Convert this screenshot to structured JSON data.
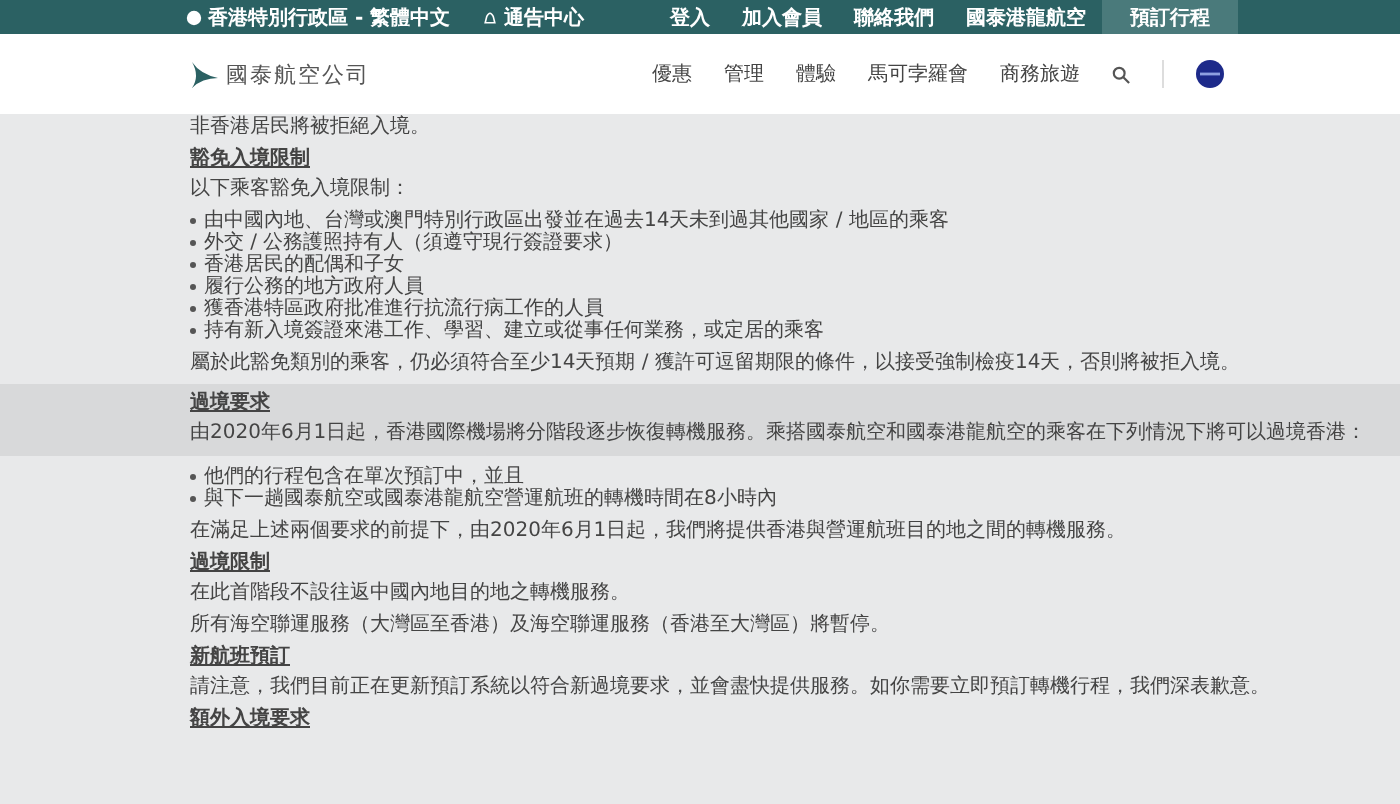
{
  "top_bar": {
    "region": "香港特別行政區 - 繁體中文",
    "notices": "通告中心",
    "links": [
      {
        "label": "登入",
        "selected": false
      },
      {
        "label": "加入會員",
        "selected": false
      },
      {
        "label": "聯絡我們",
        "selected": false
      },
      {
        "label": "國泰港龍航空",
        "selected": false
      },
      {
        "label": "預訂行程",
        "selected": true
      }
    ]
  },
  "header": {
    "logo_text": "國泰航空公司",
    "nav": [
      "優惠",
      "管理",
      "體驗",
      "馬可孛羅會",
      "商務旅遊"
    ]
  },
  "content": [
    {
      "kind": "paragraph",
      "text": "非香港居民將被拒絕入境。"
    },
    {
      "kind": "heading",
      "text": "豁免入境限制"
    },
    {
      "kind": "paragraph",
      "text": "以下乘客豁免入境限制："
    },
    {
      "kind": "list",
      "items": [
        "由中國內地、台灣或澳門特別行政區出發並在過去14天未到過其他國家 / 地區的乘客",
        "外交 / 公務護照持有人（須遵守現行簽證要求）",
        "香港居民的配偶和子女",
        "履行公務的地方政府人員",
        "獲香港特區政府批准進行抗流行病工作的人員",
        "持有新入境簽證來港工作、學習、建立或從事任何業務，或定居的乘客"
      ]
    },
    {
      "kind": "paragraph",
      "text": "屬於此豁免類別的乘客，仍必須符合至少14天預期 / 獲許可逗留期限的條件，以接受強制檢疫14天，否則將被拒入境。"
    },
    {
      "kind": "band",
      "heading": "過境要求",
      "text": "由2020年6月1日起，香港國際機場將分階段逐步恢復轉機服務。乘搭國泰航空和國泰港龍航空的乘客在下列情況下將可以過境香港："
    },
    {
      "kind": "list",
      "items": [
        "他們的行程包含在單次預訂中，並且",
        "與下一趟國泰航空或國泰港龍航空營運航班的轉機時間在8小時內"
      ]
    },
    {
      "kind": "paragraph",
      "text": "在滿足上述兩個要求的前提下，由2020年6月1日起，我們將提供香港與營運航班目的地之間的轉機服務。"
    },
    {
      "kind": "heading",
      "text": "過境限制"
    },
    {
      "kind": "paragraph",
      "text": "在此首階段不設往返中國內地目的地之轉機服務。"
    },
    {
      "kind": "paragraph",
      "text": "所有海空聯運服務（大灣區至香港）及海空聯運服務（香港至大灣區）將暫停。"
    },
    {
      "kind": "heading",
      "text": "新航班預訂"
    },
    {
      "kind": "paragraph",
      "text": "請注意，我們目前正在更新預訂系統以符合新過境要求，並會盡快提供服務。如你需要立即預訂轉機行程，我們深表歉意。"
    },
    {
      "kind": "heading",
      "text": "額外入境要求"
    }
  ]
}
